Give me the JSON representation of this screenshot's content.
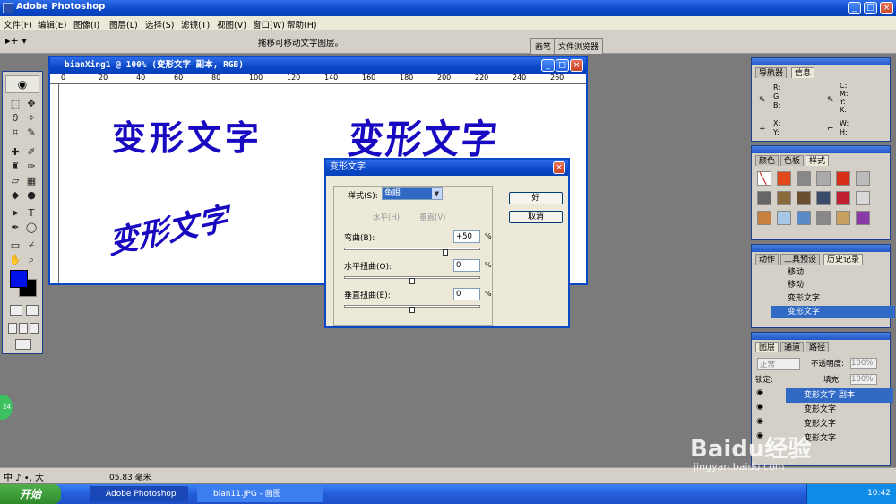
{
  "app": {
    "title": "Adobe Photoshop",
    "min": "_",
    "max": "□",
    "close": "×"
  },
  "menu": [
    "文件(F)",
    "编辑(E)",
    "图像(I)",
    "图层(L)",
    "选择(S)",
    "滤镜(T)",
    "视图(V)",
    "窗口(W)",
    "帮助(H)"
  ],
  "options": {
    "tool_preset": "▸+ ▾",
    "hint": "拖移可移动文字图层。",
    "wells": [
      "画笔",
      "文件浏览器"
    ]
  },
  "document": {
    "title": "bianXing1 @ 100% (变形文字 副本, RGB)",
    "ruler_ticks": [
      "0",
      "20",
      "40",
      "60",
      "80",
      "100",
      "120",
      "140",
      "160",
      "180",
      "200",
      "220",
      "240",
      "260"
    ],
    "text_plain": "变形文字",
    "text_arc": "变形文字",
    "text_warped": "变形文字"
  },
  "dialog": {
    "title": "变形文字",
    "style_label": "样式(S):",
    "style_value": "鱼眼",
    "horizontal": "水平(H)",
    "vertical": "垂直(V)",
    "bend_label": "弯曲(B):",
    "bend_value": "+50",
    "hdist_label": "水平扭曲(O):",
    "hdist_value": "0",
    "vdist_label": "垂直扭曲(E):",
    "vdist_value": "0",
    "pct": "%",
    "ok": "好",
    "cancel": "取消",
    "bend_level": 0.75,
    "hdist_level": 0.5,
    "vdist_level": 0.5
  },
  "navigator_panel": {
    "tabs": [
      "导航器",
      "信息"
    ],
    "rgb": "R:\nG:\nB:",
    "cmyk": "C:\nM:\nY:\nK:",
    "xy": "X:\nY:",
    "wh": "W:\nH:"
  },
  "swatches_panel": {
    "tabs": [
      "颜色",
      "色板",
      "样式"
    ]
  },
  "history_panel": {
    "tabs": [
      "动作",
      "工具预设",
      "历史记录"
    ],
    "items": [
      "移动",
      "移动",
      "变形文字",
      "变形文字"
    ]
  },
  "layers_panel": {
    "tabs": [
      "图层",
      "通道",
      "路径"
    ],
    "blend_mode": "正常",
    "opacity_label": "不透明度:",
    "opacity_value": "100%",
    "lock_label": "锁定:",
    "fill_label": "填充:",
    "fill_value": "100%",
    "layers": [
      "变形文字 副本",
      "变形文字",
      "变形文字",
      "变形文字"
    ]
  },
  "status": {
    "ime": "中 ♪ •, 大",
    "zoom": "05.83 毫米"
  },
  "taskbar": {
    "start": "开始",
    "tasks": [
      "Adobe Photoshop",
      "bian11.JPG - 画图"
    ],
    "clock": "10:42"
  },
  "overlay": {
    "badge": "24",
    "watermark": "Baidu经验",
    "watermark_url": "jingyan.baidu.com"
  },
  "colors": {
    "xp_blue": "#0a48c8",
    "text_blue": "#1808c0",
    "fg_color": "#0010e8",
    "bg_color": "#000000"
  }
}
